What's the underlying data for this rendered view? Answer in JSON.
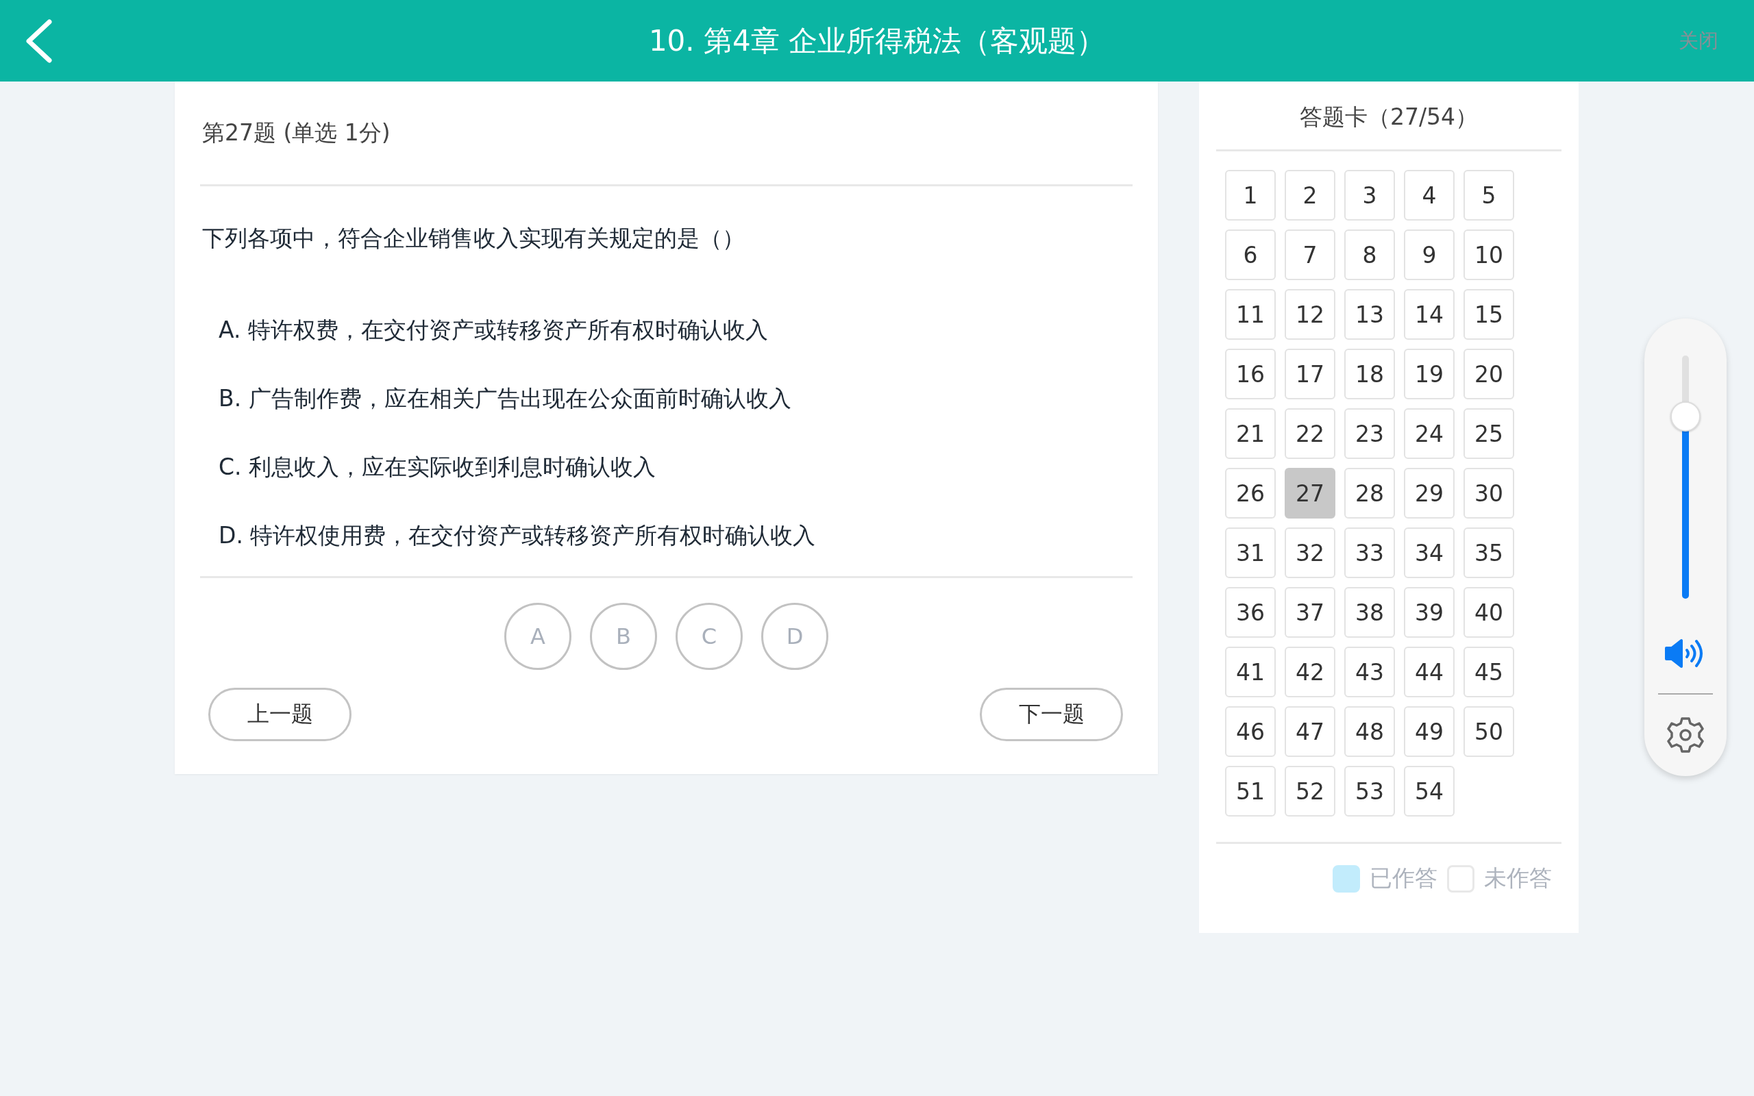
{
  "header": {
    "title": "10. 第4章 企业所得税法（客观题）",
    "close": {
      "label": "关闭",
      "disabled": true
    }
  },
  "question": {
    "heading": "第27题 (单选  1分)",
    "stem": "下列各项中，符合企业销售收入实现有关规定的是（）",
    "options": [
      "A. 特许权费，在交付资产或转移资产所有权时确认收入",
      "B. 广告制作费，应在相关广告出现在公众面前时确认收入",
      "C. 利息收入，应在实际收到利息时确认收入",
      "D. 特许权使用费，在交付资产或转移资产所有权时确认收入"
    ],
    "choices": [
      {
        "label": "A",
        "selected": false
      },
      {
        "label": "B",
        "selected": false
      },
      {
        "label": "C",
        "selected": false
      },
      {
        "label": "D",
        "selected": false
      }
    ],
    "prev_button": "上一题",
    "next_button": "下一题"
  },
  "answer_card": {
    "title": "答题卡（27/54）",
    "cells": [
      {
        "label": "1",
        "selected": false,
        "answered": false
      },
      {
        "label": "2",
        "selected": false,
        "answered": false
      },
      {
        "label": "3",
        "selected": false,
        "answered": false
      },
      {
        "label": "4",
        "selected": false,
        "answered": false
      },
      {
        "label": "5",
        "selected": false,
        "answered": false
      },
      {
        "label": "6",
        "selected": false,
        "answered": false
      },
      {
        "label": "7",
        "selected": false,
        "answered": false
      },
      {
        "label": "8",
        "selected": false,
        "answered": false
      },
      {
        "label": "9",
        "selected": false,
        "answered": false
      },
      {
        "label": "10",
        "selected": false,
        "answered": false
      },
      {
        "label": "11",
        "selected": false,
        "answered": false
      },
      {
        "label": "12",
        "selected": false,
        "answered": false
      },
      {
        "label": "13",
        "selected": false,
        "answered": false
      },
      {
        "label": "14",
        "selected": false,
        "answered": false
      },
      {
        "label": "15",
        "selected": false,
        "answered": false
      },
      {
        "label": "16",
        "selected": false,
        "answered": false
      },
      {
        "label": "17",
        "selected": false,
        "answered": false
      },
      {
        "label": "18",
        "selected": false,
        "answered": false
      },
      {
        "label": "19",
        "selected": false,
        "answered": false
      },
      {
        "label": "20",
        "selected": false,
        "answered": false
      },
      {
        "label": "21",
        "selected": false,
        "answered": false
      },
      {
        "label": "22",
        "selected": false,
        "answered": false
      },
      {
        "label": "23",
        "selected": false,
        "answered": false
      },
      {
        "label": "24",
        "selected": false,
        "answered": false
      },
      {
        "label": "25",
        "selected": false,
        "answered": false
      },
      {
        "label": "26",
        "selected": false,
        "answered": false
      },
      {
        "label": "27",
        "selected": true,
        "answered": false
      },
      {
        "label": "28",
        "selected": false,
        "answered": false
      },
      {
        "label": "29",
        "selected": false,
        "answered": false
      },
      {
        "label": "30",
        "selected": false,
        "answered": false
      },
      {
        "label": "31",
        "selected": false,
        "answered": false
      },
      {
        "label": "32",
        "selected": false,
        "answered": false
      },
      {
        "label": "33",
        "selected": false,
        "answered": false
      },
      {
        "label": "34",
        "selected": false,
        "answered": false
      },
      {
        "label": "35",
        "selected": false,
        "answered": false
      },
      {
        "label": "36",
        "selected": false,
        "answered": false
      },
      {
        "label": "37",
        "selected": false,
        "answered": false
      },
      {
        "label": "38",
        "selected": false,
        "answered": false
      },
      {
        "label": "39",
        "selected": false,
        "answered": false
      },
      {
        "label": "40",
        "selected": false,
        "answered": false
      },
      {
        "label": "41",
        "selected": false,
        "answered": false
      },
      {
        "label": "42",
        "selected": false,
        "answered": false
      },
      {
        "label": "43",
        "selected": false,
        "answered": false
      },
      {
        "label": "44",
        "selected": false,
        "answered": false
      },
      {
        "label": "45",
        "selected": false,
        "answered": false
      },
      {
        "label": "46",
        "selected": false,
        "answered": false
      },
      {
        "label": "47",
        "selected": false,
        "answered": false
      },
      {
        "label": "48",
        "selected": false,
        "answered": false
      },
      {
        "label": "49",
        "selected": false,
        "answered": false
      },
      {
        "label": "50",
        "selected": false,
        "answered": false
      },
      {
        "label": "51",
        "selected": false,
        "answered": false
      },
      {
        "label": "52",
        "selected": false,
        "answered": false
      },
      {
        "label": "53",
        "selected": false,
        "answered": false
      },
      {
        "label": "54",
        "selected": false,
        "answered": false
      }
    ],
    "legend": [
      {
        "label": "已作答",
        "color": "#c2ecfc"
      },
      {
        "label": "未作答",
        "color": "#ffffff"
      }
    ]
  },
  "volume": {
    "level": 0.75
  }
}
